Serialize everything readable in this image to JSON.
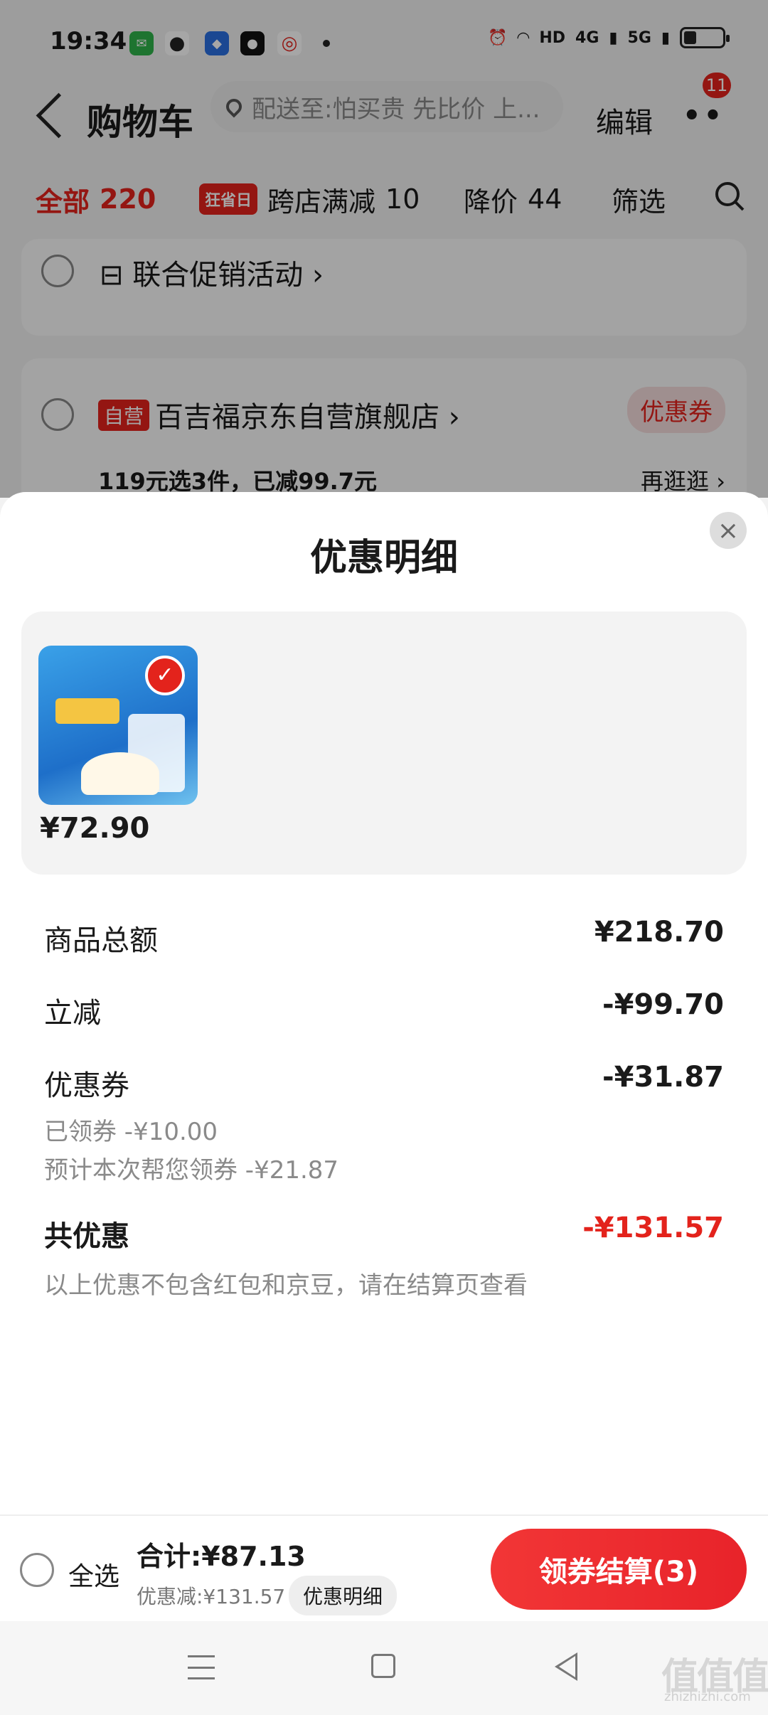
{
  "status_bar": {
    "time": "19:34",
    "network_labels": [
      "HD",
      "4G",
      "5G"
    ]
  },
  "header": {
    "title": "购物车",
    "address": "配送至:怕买贵 先比价 上...",
    "edit_label": "编辑",
    "notification_count": "11"
  },
  "filter_tabs": [
    {
      "label": "全部",
      "count": "220"
    },
    {
      "tag": "狂省日",
      "label": "跨店满减",
      "count": "10"
    },
    {
      "label": "降价",
      "count": "44"
    },
    {
      "label": "筛选"
    }
  ],
  "promo_card": {
    "label": "联合促销活动 ›"
  },
  "store_card": {
    "tag": "自营",
    "store_name": "百吉福京东自营旗舰店 ›",
    "coupon_label": "优惠券",
    "promo_line": "119元选3件，已减99.7元",
    "browse_label": "再逛逛 ›"
  },
  "modal": {
    "title": "优惠明细",
    "close_icon": "close-icon",
    "product_price": "¥72.90",
    "rows": {
      "subtotal_label": "商品总额",
      "subtotal_value": "¥218.70",
      "instant_label": "立减",
      "instant_value": "-¥99.70",
      "coupon_label": "优惠券",
      "coupon_value": "-¥31.87",
      "claimed": "已领券 -¥10.00",
      "estimated": "预计本次帮您领券 -¥21.87",
      "total_label": "共优惠",
      "total_value": "-¥131.57",
      "note": "以上优惠不包含红包和京豆，请在结算页查看"
    }
  },
  "bottom_bar": {
    "select_all": "全选",
    "total": "合计:¥87.13",
    "discount": "优惠减:¥131.57",
    "detail_label": "优惠明细",
    "checkout_label": "领券结算(3)"
  },
  "watermark": {
    "text": "值值值",
    "sub": "zhizhizhi.com"
  },
  "colors": {
    "accent": "#e3231c",
    "background": "#f2f2f2"
  }
}
